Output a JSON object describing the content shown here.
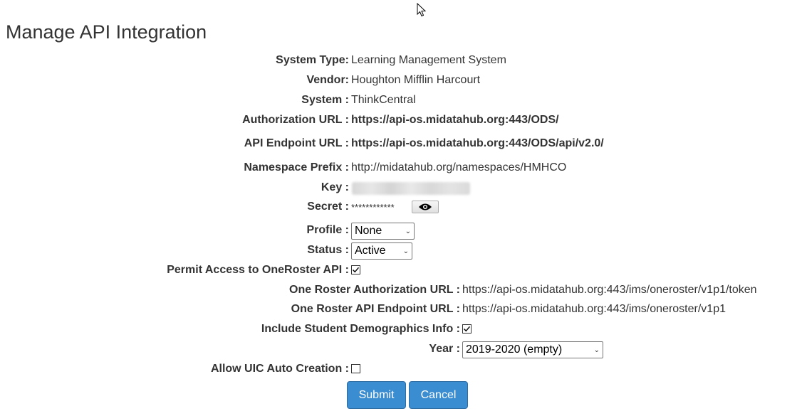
{
  "page": {
    "title": "Manage API Integration"
  },
  "fields": {
    "system_type": {
      "label": "System Type:",
      "value": "Learning Management System"
    },
    "vendor": {
      "label": "Vendor:",
      "value": "Houghton Mifflin Harcourt"
    },
    "system": {
      "label": "System :",
      "value": "ThinkCentral"
    },
    "authorization_url": {
      "label": "Authorization URL :",
      "value": "https://api-os.midatahub.org:443/ODS/"
    },
    "api_endpoint_url": {
      "label": "API Endpoint URL :",
      "value": "https://api-os.midatahub.org:443/ODS/api/v2.0/"
    },
    "namespace_prefix": {
      "label": "Namespace Prefix :",
      "value": "http://midatahub.org/namespaces/HMHCO"
    },
    "key": {
      "label": "Key :"
    },
    "secret": {
      "label": "Secret :",
      "value": "************"
    },
    "profile": {
      "label": "Profile :",
      "selected": "None"
    },
    "status": {
      "label": "Status :",
      "selected": "Active"
    },
    "permit_oneroster": {
      "label": "Permit Access to OneRoster API :",
      "checked": true
    },
    "oneroster_auth_url": {
      "label": "One Roster Authorization URL :",
      "value": "https://api-os.midatahub.org:443/ims/oneroster/v1p1/token"
    },
    "oneroster_endpoint_url": {
      "label": "One Roster API Endpoint URL :",
      "value": "https://api-os.midatahub.org:443/ims/oneroster/v1p1"
    },
    "include_demographics": {
      "label": "Include Student Demographics Info :",
      "checked": true
    },
    "year": {
      "label": "Year :",
      "selected": "2019-2020 (empty)"
    },
    "allow_uic": {
      "label": "Allow UIC Auto Creation :",
      "checked": false
    }
  },
  "buttons": {
    "submit": "Submit",
    "cancel": "Cancel"
  },
  "icons": {
    "secret_toggle": "eye-icon",
    "cursor": "mouse-pointer-icon"
  },
  "colors": {
    "primary_button": "#3a8dd0",
    "text": "#333333"
  }
}
